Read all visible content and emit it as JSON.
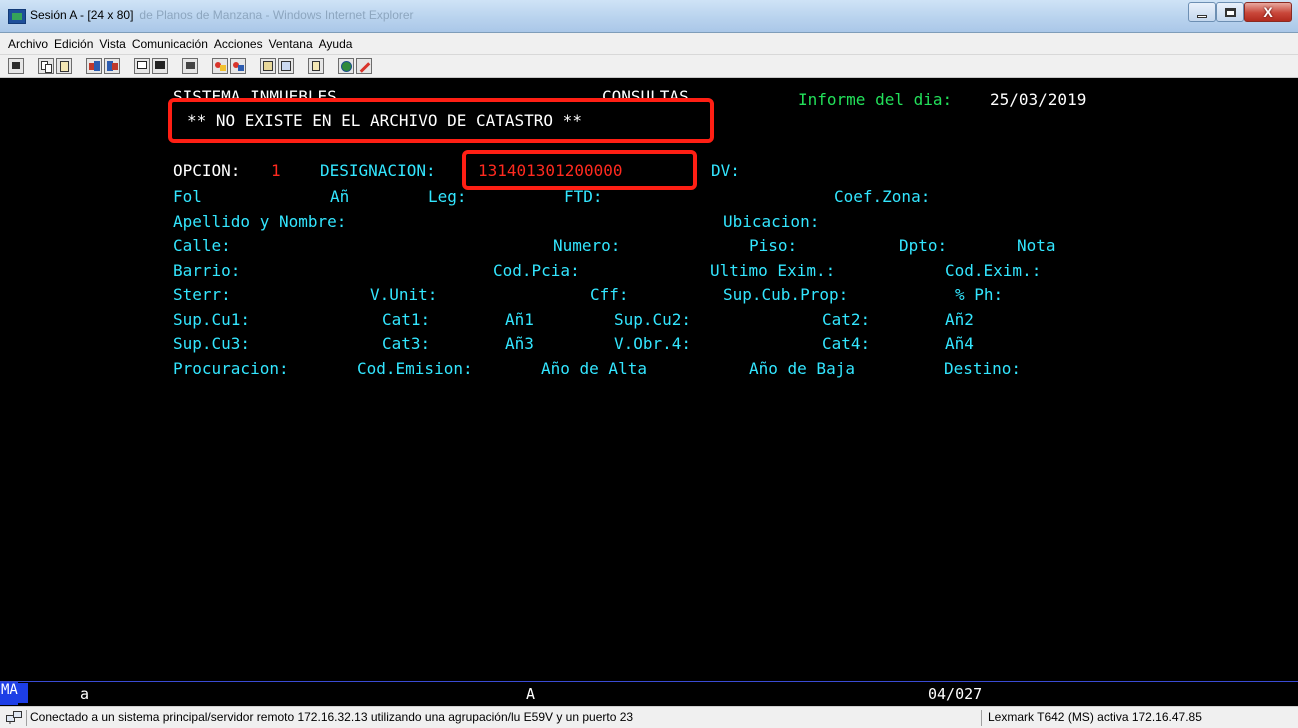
{
  "window": {
    "title": "Sesión A - [24 x 80]",
    "title_faded": "de Planos de Manzana - Windows Internet Explorer",
    "close_label": "X"
  },
  "menu": [
    "Archivo",
    "Edición",
    "Vista",
    "Comunicación",
    "Acciones",
    "Ventana",
    "Ayuda"
  ],
  "toolbar_icons": [
    "screen-icon",
    "copy-icon",
    "paste-icon",
    "send-icon",
    "receive-icon",
    "display-icon",
    "display-alt-icon",
    "chart-icon",
    "macro-icon",
    "macro-stop-icon",
    "transfer-icon",
    "transfer-alt-icon",
    "clipboard-icon",
    "globe-icon",
    "edit-icon"
  ],
  "terminal": {
    "header": {
      "system": "SISTEMA INMUEBLES",
      "section": "CONSULTAS",
      "report_label": "Informe del dia:",
      "report_date": "25/03/2019"
    },
    "message": "** NO EXISTE EN EL ARCHIVO DE CATASTRO **",
    "opcion_label": "OPCION:",
    "opcion_value": "1",
    "designacion_label": "DESIGNACION:",
    "designacion_value": "131401301200000",
    "dv_label": "DV:",
    "fields": {
      "fol": "Fol",
      "an": "Añ",
      "leg": "Leg:",
      "ftd": "FTD:",
      "coef_zona": "Coef.Zona:",
      "apellido": "Apellido y Nombre:",
      "ubicacion": "Ubicacion:",
      "calle": "Calle:",
      "numero": "Numero:",
      "piso": "Piso:",
      "dpto": "Dpto:",
      "nota": "Nota",
      "barrio": "Barrio:",
      "cod_pcia": "Cod.Pcia:",
      "ultimo_exim": "Ultimo Exim.:",
      "cod_exim": "Cod.Exim.:",
      "sterr": "Sterr:",
      "v_unit": "V.Unit:",
      "cff": "Cff:",
      "sup_cub_prop": "Sup.Cub.Prop:",
      "ph": "% Ph:",
      "sup_cu1": "Sup.Cu1:",
      "cat1": "Cat1:",
      "an1": "Añ1",
      "sup_cu2": "Sup.Cu2:",
      "cat2": "Cat2:",
      "an2": "Añ2",
      "sup_cu3": "Sup.Cu3:",
      "cat3": "Cat3:",
      "an3": "Añ3",
      "v_obr4": "V.Obr.4:",
      "cat4": "Cat4:",
      "an4": "Añ4",
      "procuracion": "Procuracion:",
      "cod_emision": "Cod.Emision:",
      "ano_alta": "Año de Alta",
      "ano_baja": "Año de Baja",
      "destino": "Destino:"
    }
  },
  "oia": {
    "mode": "MA",
    "session": "a",
    "indicator": "A",
    "cursor_pos": "04/027"
  },
  "status": {
    "connection": "Conectado a un sistema principal/servidor remoto 172.16.32.13 utilizando una agrupación/lu E59V y un puerto 23",
    "printer": "Lexmark T642 (MS) activa 172.16.47.85"
  },
  "colors": {
    "label": "#33e6ff",
    "value": "#ff2a1f",
    "highlight": "#ff1f14",
    "header": "#22e05a"
  }
}
